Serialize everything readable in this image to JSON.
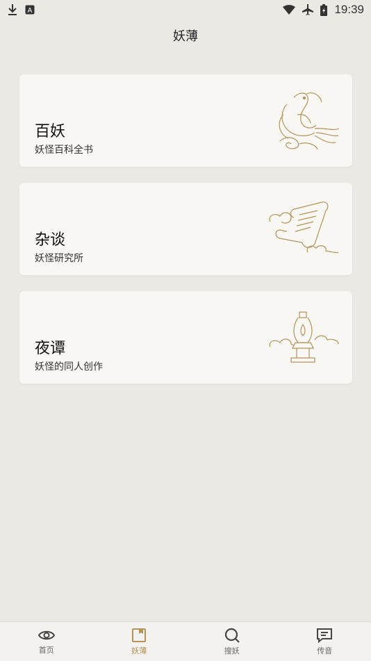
{
  "status_bar": {
    "time": "19:39",
    "icons": [
      "download-icon",
      "text-notification-icon",
      "wifi-icon",
      "airplane-icon",
      "battery-icon"
    ]
  },
  "header": {
    "title": "妖薄"
  },
  "cards": [
    {
      "title": "百妖",
      "subtitle": "妖怪百科全书",
      "icon": "phoenix-icon"
    },
    {
      "title": "杂谈",
      "subtitle": "妖怪研究所",
      "icon": "scroll-icon"
    },
    {
      "title": "夜谭",
      "subtitle": "妖怪的同人创作",
      "icon": "lamp-icon"
    }
  ],
  "tabbar": {
    "active": "妖薄",
    "active_color": "#b4935a",
    "items": [
      {
        "label": "首页",
        "icon": "eye-icon"
      },
      {
        "label": "妖薄",
        "icon": "book-icon"
      },
      {
        "label": "搜妖",
        "icon": "search-icon"
      },
      {
        "label": "传音",
        "icon": "message-icon"
      }
    ]
  },
  "colors": {
    "background": "#ebe9e4",
    "card": "#f8f7f3",
    "accent": "#b4935a"
  }
}
